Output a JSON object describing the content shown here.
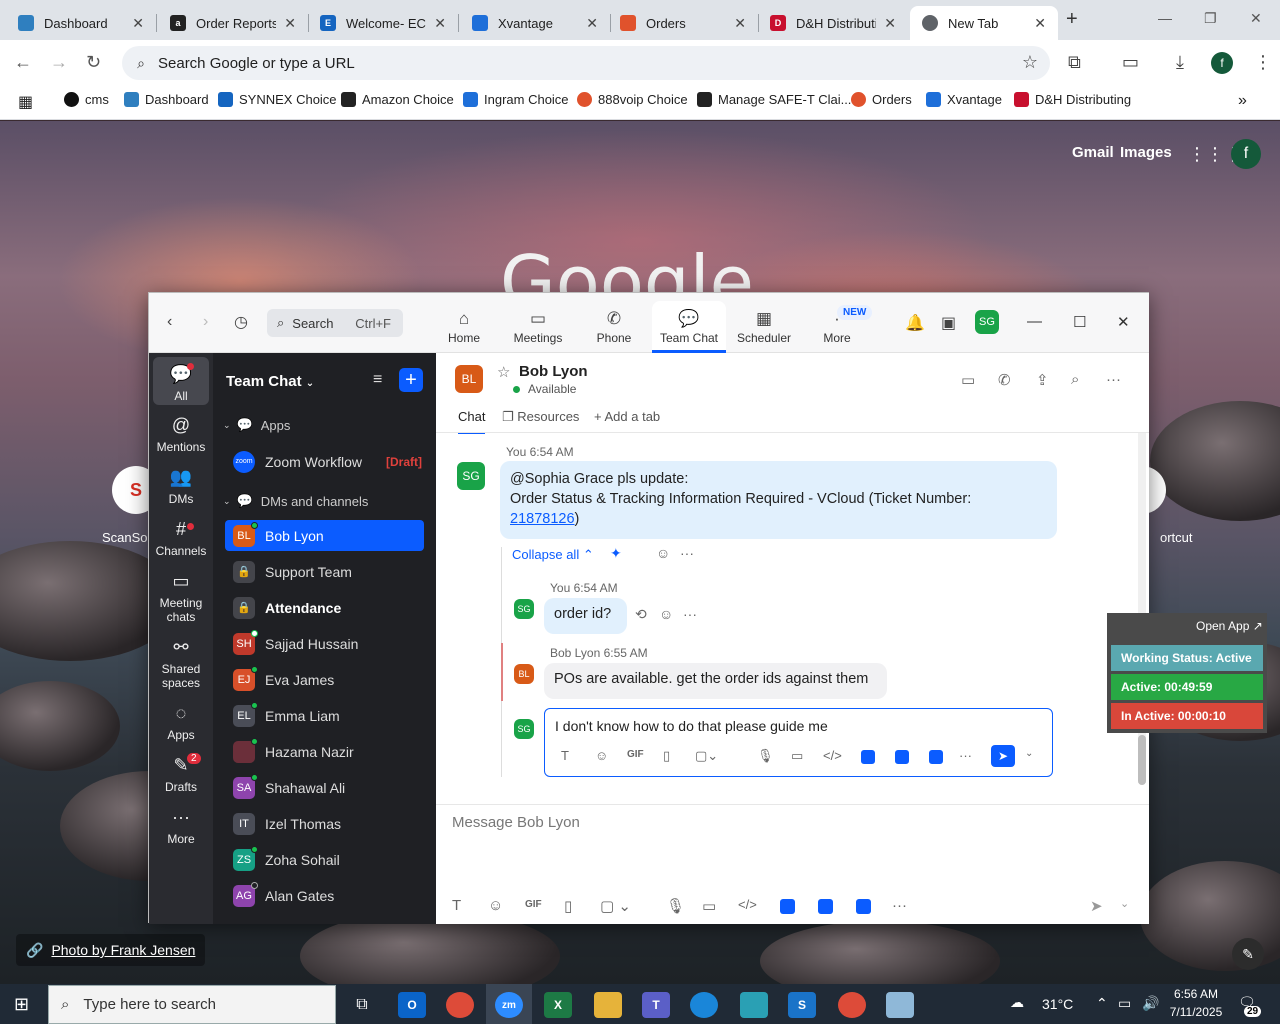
{
  "browser": {
    "tabs": [
      {
        "title": "Dashboard",
        "fav_color": "#2f7fbf"
      },
      {
        "title": "Order Reports",
        "fav_color": "#222222"
      },
      {
        "title": "Welcome- ECE",
        "fav_color": "#1565c0"
      },
      {
        "title": "Xvantage",
        "fav_color": "#1e6fd9"
      },
      {
        "title": "Orders",
        "fav_color": "#e0522c"
      },
      {
        "title": "D&H Distributi",
        "fav_color": "#c8102e"
      },
      {
        "title": "New Tab",
        "fav_color": "#5f6368"
      }
    ],
    "omnibox_placeholder": "Search Google or type a URL",
    "profile_initial": "f",
    "bookmarks": [
      {
        "label": "cms",
        "color": "#111111"
      },
      {
        "label": "Dashboard",
        "color": "#2f7fbf"
      },
      {
        "label": "SYNNEX Choice",
        "color": "#1565c0"
      },
      {
        "label": "Amazon Choice",
        "color": "#222222"
      },
      {
        "label": "Ingram Choice",
        "color": "#1e6fd9"
      },
      {
        "label": "888voip Choice",
        "color": "#e0522c"
      },
      {
        "label": "Manage SAFE-T Clai...",
        "color": "#222222"
      },
      {
        "label": "Orders",
        "color": "#e0522c"
      },
      {
        "label": "Xvantage",
        "color": "#1e6fd9"
      },
      {
        "label": "D&H Distributing",
        "color": "#c8102e"
      }
    ]
  },
  "ntp": {
    "gmail": "Gmail",
    "images": "Images",
    "profile_initial": "f",
    "logo": "Google",
    "shortcut_left": "ScanSou",
    "shortcut_right": "ortcut",
    "photo_credit": "Photo by Frank Jensen"
  },
  "zoom": {
    "search_label": "Search",
    "search_shortcut": "Ctrl+F",
    "top_tabs": [
      "Home",
      "Meetings",
      "Phone",
      "Team Chat",
      "Scheduler",
      "More"
    ],
    "new_badge": "NEW",
    "user_initials": "SG",
    "rail": [
      {
        "label": "All"
      },
      {
        "label": "Mentions"
      },
      {
        "label": "DMs"
      },
      {
        "label": "Channels"
      },
      {
        "label": "Meeting chats"
      },
      {
        "label": "Shared spaces"
      },
      {
        "label": "Apps"
      },
      {
        "label": "Drafts",
        "badge": "2"
      },
      {
        "label": "More"
      }
    ],
    "list_title": "Team Chat",
    "sections": {
      "apps": "Apps",
      "dms": "DMs and channels"
    },
    "app_item": {
      "label": "Zoom Workflow",
      "draft": "[Draft]",
      "icon_text": "zoom"
    },
    "contacts": [
      {
        "initials": "BL",
        "name": "Bob Lyon",
        "color": "#d85a17"
      },
      {
        "initials": "",
        "name": "Support Team",
        "color": "#44454b"
      },
      {
        "initials": "",
        "name": "Attendance",
        "color": "#44454b"
      },
      {
        "initials": "SH",
        "name": "Sajjad Hussain",
        "color": "#c0392b"
      },
      {
        "initials": "EJ",
        "name": "Eva James",
        "color": "#d8502a"
      },
      {
        "initials": "EL",
        "name": "Emma Liam",
        "color": "#4a4d57"
      },
      {
        "initials": "",
        "name": "Hazama Nazir",
        "color": "#6b2f3a"
      },
      {
        "initials": "SA",
        "name": "Shahawal Ali",
        "color": "#8e44ad"
      },
      {
        "initials": "IT",
        "name": "Izel Thomas",
        "color": "#4a4d57"
      },
      {
        "initials": "ZS",
        "name": "Zoha Sohail",
        "color": "#16a085"
      },
      {
        "initials": "AG",
        "name": "Alan Gates",
        "color": "#8e44ad"
      }
    ],
    "chat": {
      "contact_initials": "BL",
      "contact_name": "Bob Lyon",
      "contact_status": "Available",
      "subtabs": [
        "Chat",
        "Resources",
        "Add a tab"
      ],
      "msg1_time": "You 6:54 AM",
      "msg1_line1": "@Sophia Grace pls update:",
      "msg1_line2": "Order Status & Tracking Information Required - VCloud (Ticket Number:",
      "msg1_link": "21878126",
      "msg1_end": ")",
      "collapse": "Collapse all",
      "reply1_time": "You 6:54 AM",
      "reply1_text": "order id?",
      "reply2_time": "Bob Lyon 6:55 AM",
      "reply2_text": "POs are available. get the order ids against them",
      "reply_draft": "I don't know how to do that please guide me",
      "compose_placeholder": "Message Bob Lyon",
      "gif": "GIF"
    }
  },
  "tracker": {
    "open_app": "Open App ↗",
    "working": "Working Status: Active",
    "active": "Active: 00:49:59",
    "inactive": "In Active: 00:00:10",
    "colors": {
      "working": "#5aa8b0",
      "active": "#28a844",
      "inactive": "#d9473a"
    }
  },
  "taskbar": {
    "search_placeholder": "Type here to search",
    "temperature": "31°C",
    "time": "6:56 AM",
    "date": "7/11/2025",
    "notifications": "29"
  }
}
